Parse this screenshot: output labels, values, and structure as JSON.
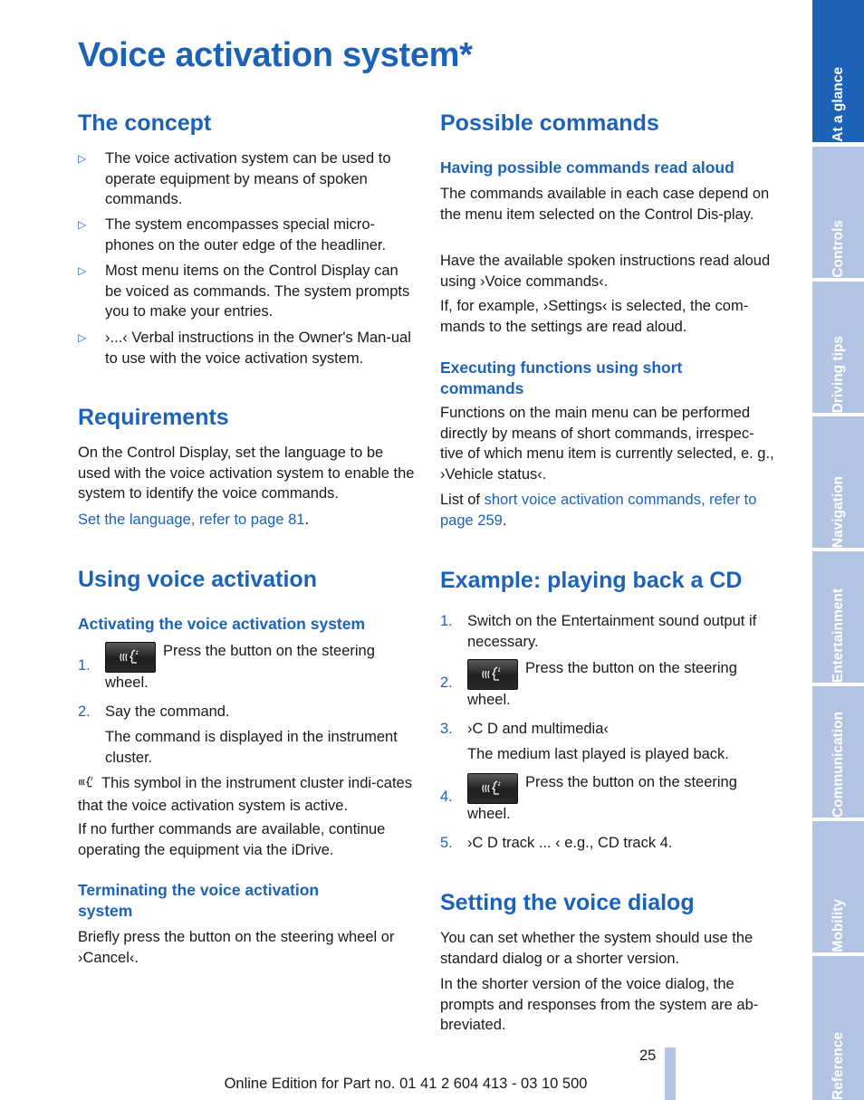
{
  "page": {
    "title": "Voice activation system*",
    "page_number": "25",
    "footer": "Online Edition for Part no. 01 41 2 604 413 - 03 10 500"
  },
  "side_tabs": [
    {
      "label": "At a glance",
      "active": true
    },
    {
      "label": "Controls",
      "active": false
    },
    {
      "label": "Driving tips",
      "active": false
    },
    {
      "label": "Navigation",
      "active": false
    },
    {
      "label": "Entertainment",
      "active": false
    },
    {
      "label": "Communication",
      "active": false
    },
    {
      "label": "Mobility",
      "active": false
    },
    {
      "label": "Reference",
      "active": false
    }
  ],
  "concept": {
    "heading": "The concept",
    "bullets": [
      "The voice activation system can be used to operate equipment by means of spoken commands.",
      "The system encompasses special micro-phones on the outer edge of the headliner.",
      "Most menu items on the Control Display can be voiced as commands. The system prompts you to make your entries.",
      "›...‹ Verbal instructions in the Owner's Man-ual to use with the voice activation system."
    ]
  },
  "requirements": {
    "heading": "Requirements",
    "text": "On the Control Display, set the language to be used with the voice activation system to enable the system to identify the voice commands.",
    "link": "Set the language, refer to page 81",
    "link_suffix": "."
  },
  "using": {
    "heading": "Using voice activation",
    "activating_heading": "Activating the voice activation system",
    "steps": [
      {
        "num": "1.",
        "text": "Press the button on the steering wheel.",
        "has_button": true
      },
      {
        "num": "2.",
        "text": "Say the command.",
        "has_button": false
      }
    ],
    "step2_note": "The command is displayed in the instrument cluster.",
    "symbol_note": "This symbol in the instrument cluster indi-cates that the voice activation system is active.",
    "no_further": "If no further commands are available, continue operating the equipment via the iDrive.",
    "terminating_heading": "Terminating the voice activation system",
    "terminating_text": "Briefly press the button on the steering wheel or ›Cancel‹."
  },
  "possible": {
    "heading": "Possible commands",
    "read_aloud_heading": "Having possible commands read aloud",
    "p1": "The commands available in each case depend on the menu item selected on the Control Dis-play.",
    "p2": "Have the available spoken instructions read aloud using ›Voice commands‹.",
    "p3": "If, for example, ›Settings‹ is selected, the com-mands to the settings are read aloud.",
    "short_heading": "Executing functions using short commands",
    "p4": "Functions on the main menu can be performed directly by means of short commands, irrespec-tive of which menu item is currently selected, e. g., ›Vehicle status‹.",
    "list_prefix": "List of ",
    "list_link": "short voice activation commands, refer to page 259",
    "list_suffix": "."
  },
  "example": {
    "heading": "Example: playing back a CD",
    "steps": [
      {
        "num": "1.",
        "text": "Switch on the Entertainment sound output if necessary."
      },
      {
        "num": "2.",
        "text": "Press the button on the steering wheel."
      },
      {
        "num": "3.",
        "text": "›C D and multimedia‹"
      },
      {
        "num": "4.",
        "text": "Press the button on the steering wheel."
      },
      {
        "num": "5.",
        "text": "›C D track ... ‹ e.g., CD track 4."
      }
    ],
    "step3_note": "The medium last played is played back."
  },
  "dialog": {
    "heading": "Setting the voice dialog",
    "p1": "You can set whether the system should use the standard dialog or a shorter version.",
    "p2": "In the shorter version of the voice dialog, the prompts and responses from the system are ab-breviated."
  }
}
